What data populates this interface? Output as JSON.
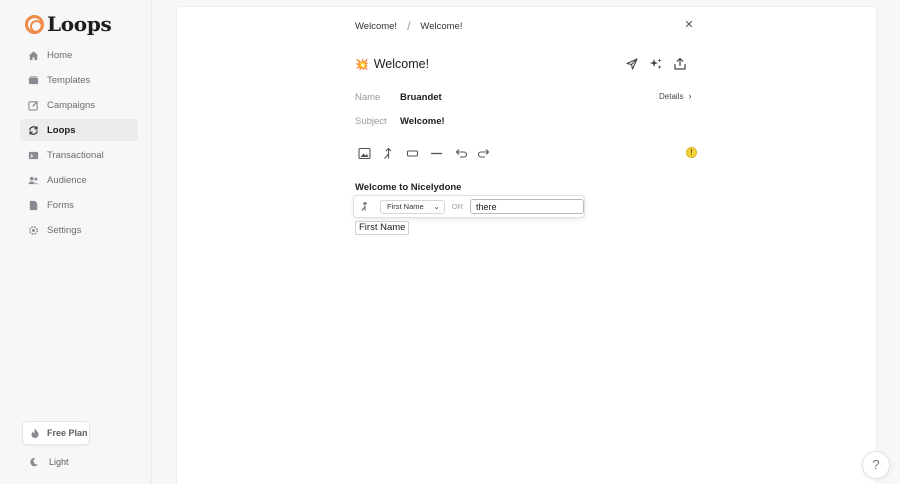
{
  "brand": {
    "name": "Loops",
    "accent": "#f08a4b"
  },
  "sidebar": {
    "items": [
      {
        "label": "Home",
        "icon": "home-icon",
        "active": false
      },
      {
        "label": "Templates",
        "icon": "templates-icon",
        "active": false
      },
      {
        "label": "Campaigns",
        "icon": "campaigns-icon",
        "active": false
      },
      {
        "label": "Loops",
        "icon": "loops-icon",
        "active": true
      },
      {
        "label": "Transactional",
        "icon": "transactional-icon",
        "active": false
      },
      {
        "label": "Audience",
        "icon": "audience-icon",
        "active": false
      },
      {
        "label": "Forms",
        "icon": "forms-icon",
        "active": false
      },
      {
        "label": "Settings",
        "icon": "settings-icon",
        "active": false
      }
    ],
    "plan_label": "Free Plan",
    "theme_label": "Light"
  },
  "breadcrumb": {
    "parent": "Welcome!",
    "separator": "/",
    "current": "Welcome!"
  },
  "email": {
    "title": "Welcome!",
    "title_emoji": "💥",
    "name_label": "Name",
    "name_value": "Bruandet",
    "subject_label": "Subject",
    "subject_value": "Welcome!",
    "details_label": "Details",
    "warning_glyph": "!"
  },
  "editor": {
    "heading_text": "Welcome to Nicelydone",
    "tag_select_value": "First Name",
    "or_label": "OR",
    "fallback_value": "there",
    "merge_tag_label": "First Name"
  },
  "help": {
    "label": "?"
  }
}
